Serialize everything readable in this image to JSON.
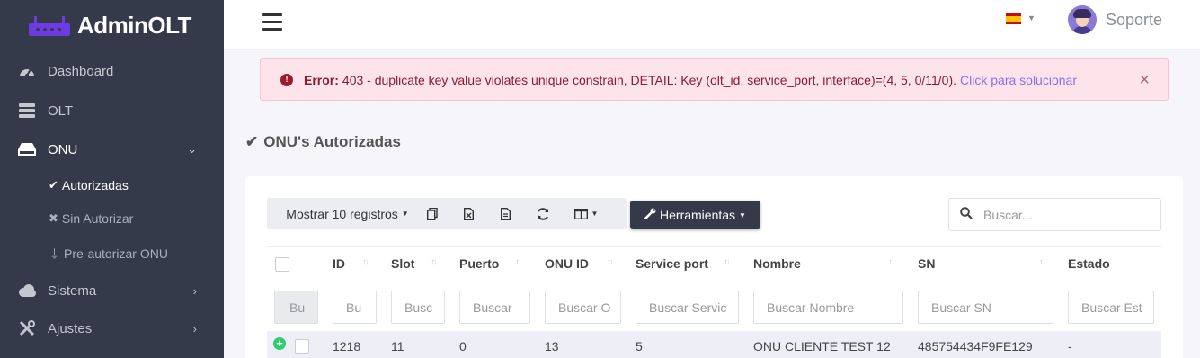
{
  "app": {
    "name": "AdminOLT"
  },
  "sidebar": {
    "items": [
      {
        "label": "Dashboard",
        "icon": "dashboard-icon"
      },
      {
        "label": "OLT",
        "icon": "server-icon"
      },
      {
        "label": "ONU",
        "icon": "hdd-icon"
      },
      {
        "label": "Sistema",
        "icon": "cloud-icon"
      },
      {
        "label": "Ajustes",
        "icon": "tools-icon"
      }
    ],
    "subitems": [
      {
        "label": "Autorizadas",
        "icon": "check-icon"
      },
      {
        "label": "Sin Autorizar",
        "icon": "x-icon"
      },
      {
        "label": "Pre-autorizar ONU",
        "icon": "plug-icon"
      }
    ]
  },
  "topbar": {
    "user": "Soporte",
    "language_icon": "spain-flag-icon"
  },
  "alert": {
    "prefix": "Error:",
    "message": "403 - duplicate key value violates unique constrain, DETAIL: Key (olt_id, service_port, interface)=(4, 5, 0/11/0).",
    "link": "Click para solucionar",
    "close": "×",
    "color": "#fce4ea"
  },
  "section": {
    "title": "ONU's Autorizadas"
  },
  "toolbar": {
    "show_label": "Mostrar 10 registros",
    "tools_label": "Herramientas",
    "search_placeholder": "Buscar..."
  },
  "table": {
    "headers": [
      "ID",
      "Slot",
      "Puerto",
      "ONU ID",
      "Service port",
      "Nombre",
      "SN",
      "Estado"
    ],
    "filters": [
      "Bu",
      "Bu",
      "Busc",
      "Buscar",
      "Buscar O",
      "Buscar Servic",
      "Buscar Nombre",
      "Buscar SN",
      "Buscar Est"
    ],
    "rows": [
      [
        "1218",
        "11",
        "0",
        "13",
        "5",
        "ONU CLIENTE TEST 12",
        "485754434F9FE129",
        "-"
      ]
    ]
  }
}
